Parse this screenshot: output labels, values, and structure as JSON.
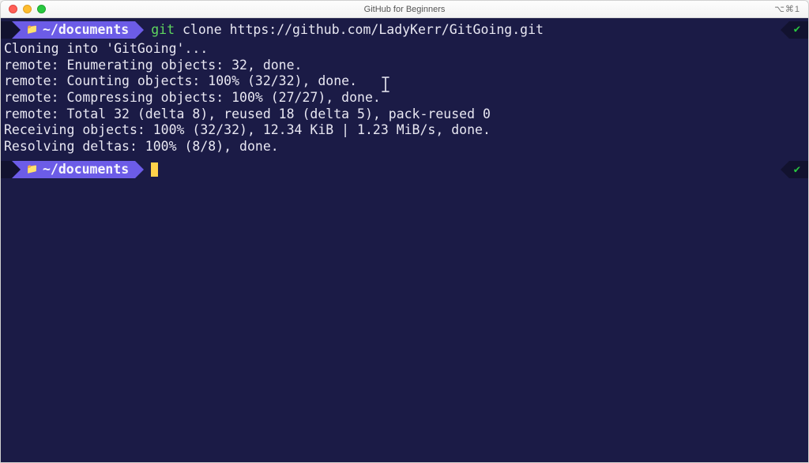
{
  "window": {
    "title": "GitHub for Beginners",
    "right_indicator": "⌥⌘1"
  },
  "prompt1": {
    "path": "~/documents",
    "cmd_git": "git",
    "cmd_rest": " clone https://github.com/LadyKerr/GitGoing.git"
  },
  "output": {
    "l1": "Cloning into 'GitGoing'...",
    "l2": "remote: Enumerating objects: 32, done.",
    "l3": "remote: Counting objects: 100% (32/32), done.",
    "l4": "remote: Compressing objects: 100% (27/27), done.",
    "l5": "remote: Total 32 (delta 8), reused 18 (delta 5), pack-reused 0",
    "l6": "Receiving objects: 100% (32/32), 12.34 KiB | 1.23 MiB/s, done.",
    "l7": "Resolving deltas: 100% (8/8), done."
  },
  "prompt2": {
    "path": "~/documents"
  },
  "glyphs": {
    "apple": "",
    "folder": "📁",
    "check": "✔"
  }
}
